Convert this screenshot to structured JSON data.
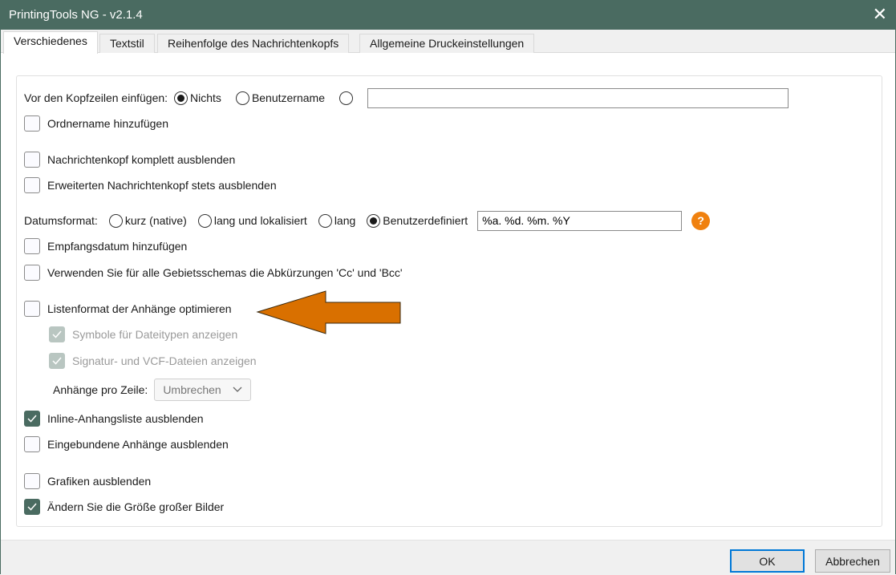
{
  "window": {
    "title": "PrintingTools NG - v2.1.4",
    "close": "✕"
  },
  "tabs": [
    "Verschiedenes",
    "Textstil",
    "Reihenfolge des Nachrichtenkopfs",
    "Allgemeine Druckeinstellungen"
  ],
  "header_insert": {
    "label": "Vor den Kopfzeilen einfügen:",
    "options": [
      "Nichts",
      "Benutzername"
    ],
    "selected": "Nichts",
    "custom_value": ""
  },
  "options": {
    "folder_name": {
      "label": "Ordnername hinzufügen",
      "checked": false
    },
    "hide_header": {
      "label": "Nachrichtenkopf komplett ausblenden",
      "checked": false
    },
    "hide_ext_header": {
      "label": "Erweiterten Nachrichtenkopf stets ausblenden",
      "checked": false
    },
    "receive_date": {
      "label": "Empfangsdatum hinzufügen",
      "checked": false
    },
    "cc_bcc": {
      "label": "Verwenden Sie für alle Gebietsschemas die Abkürzungen 'Cc' und 'Bcc'",
      "checked": false
    },
    "list_format": {
      "label": "Listenformat der Anhänge optimieren",
      "checked": false
    },
    "file_icons": {
      "label": "Symbole für Dateitypen anzeigen",
      "checked": true,
      "disabled": true
    },
    "sig_vcf": {
      "label": "Signatur- und VCF-Dateien anzeigen",
      "checked": true,
      "disabled": true
    },
    "hide_inline_list": {
      "label": "Inline-Anhangsliste ausblenden",
      "checked": true
    },
    "hide_embedded": {
      "label": "Eingebundene Anhänge ausblenden",
      "checked": false
    },
    "hide_images": {
      "label": "Grafiken ausblenden",
      "checked": false
    },
    "resize_images": {
      "label": "Ändern Sie die Größe großer Bilder",
      "checked": true
    }
  },
  "date_format": {
    "label": "Datumsformat:",
    "options": [
      "kurz (native)",
      "lang und lokalisiert",
      "lang",
      "Benutzerdefiniert"
    ],
    "selected": "Benutzerdefiniert",
    "custom_value": "%a. %d. %m. %Y",
    "help": "?"
  },
  "attachments_per_row": {
    "label": "Anhänge pro Zeile:",
    "value": "Umbrechen"
  },
  "annotation": {
    "arrow_color": "#d97000"
  },
  "buttons": {
    "ok": "OK",
    "cancel": "Abbrechen"
  }
}
